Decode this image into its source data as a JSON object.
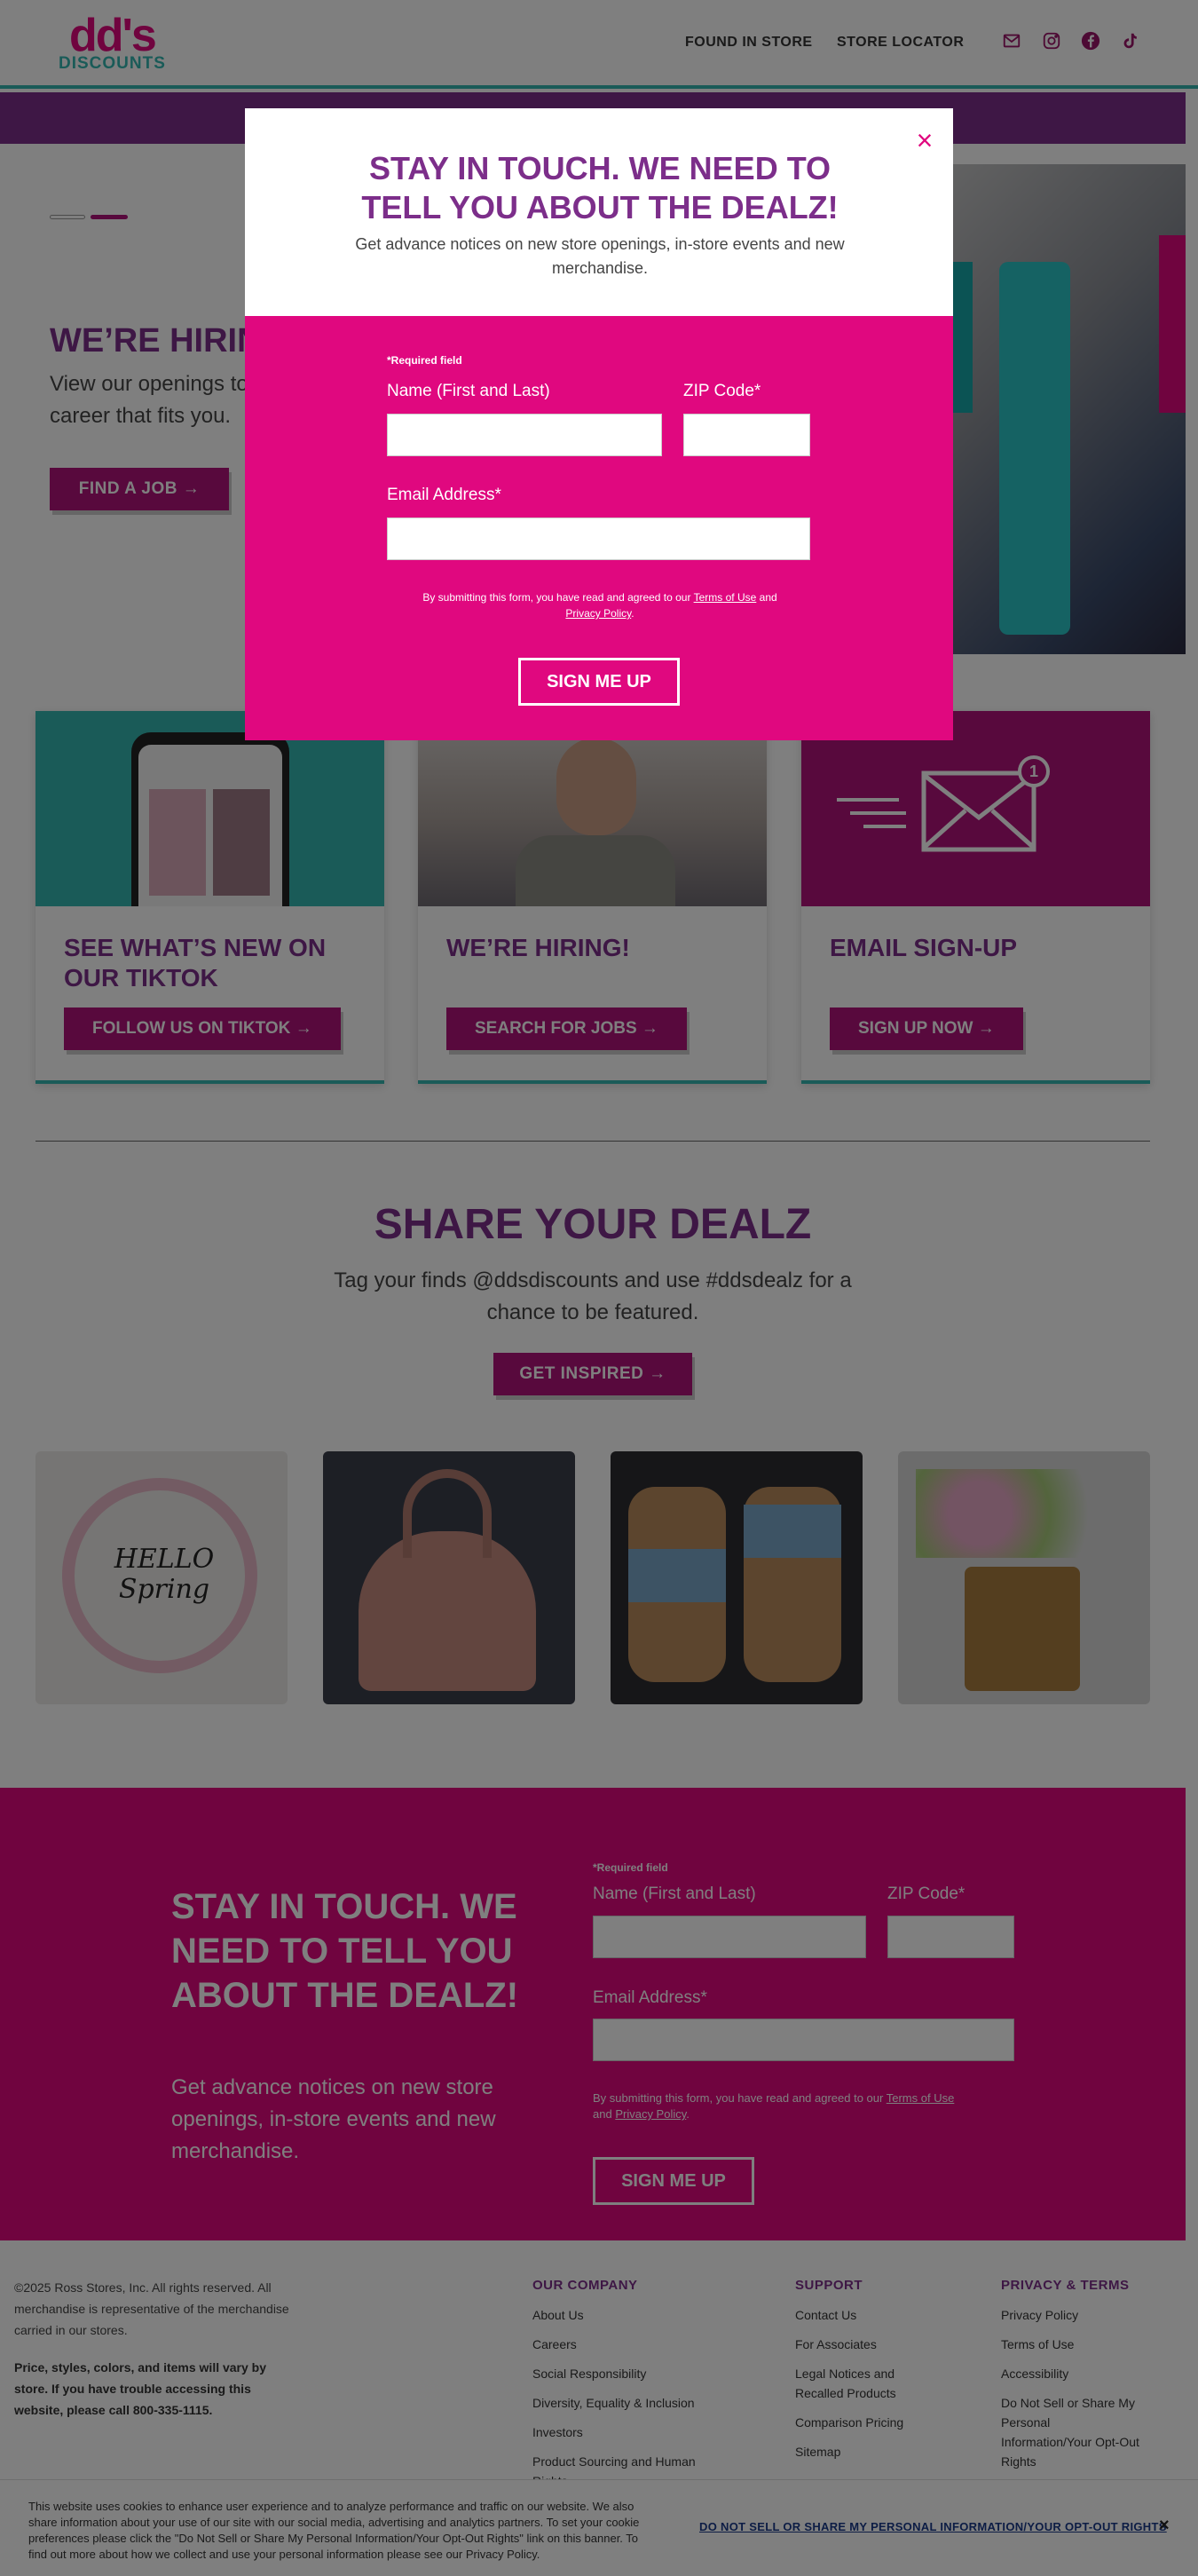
{
  "header": {
    "logo_top": "dd's",
    "logo_bottom": "DISCOUNTS",
    "nav": [
      "FOUND IN STORE",
      "STORE LOCATOR"
    ],
    "social_icons": [
      "mail-icon",
      "instagram-icon",
      "facebook-icon",
      "tiktok-icon"
    ]
  },
  "hero": {
    "title": "WE’RE HIRING!",
    "text": "View our openings today and find the career that fits you.",
    "button": "FIND A JOB"
  },
  "cards": [
    {
      "title": "SEE WHAT’S NEW ON OUR TIKTOK",
      "button": "FOLLOW US ON TIKTOK"
    },
    {
      "title": "WE’RE HIRING!",
      "button": "SEARCH FOR JOBS"
    },
    {
      "title": "EMAIL SIGN-UP",
      "button": "SIGN UP NOW",
      "badge": "1"
    }
  ],
  "share": {
    "title": "SHARE YOUR DEALZ",
    "text": "Tag your finds @ddsdiscounts and use #ddsdealz for a chance to be featured.",
    "button": "GET INSPIRED",
    "photo1_text": "HELLO Spring"
  },
  "signup": {
    "title": "STAY IN TOUCH. WE NEED TO TELL YOU ABOUT THE DEALZ!",
    "text": "Get advance notices on new store openings, in-store events and new merchandise.",
    "required": "*Required field",
    "name_label": "Name (First and Last)",
    "zip_label": "ZIP Code*",
    "email_label": "Email Address*",
    "legal_pre": "By submitting this form, you have read and agreed to our",
    "terms": "Terms of Use",
    "and": "and",
    "privacy": "Privacy Policy",
    "period": ".",
    "button": "SIGN ME UP"
  },
  "footer": {
    "copyright": "©2025 Ross Stores, Inc. All rights reserved. All merchandise is representative of the merchandise carried in our stores.",
    "notice": "Price, styles, colors, and items will vary by store. If you have trouble accessing this website, please call 800-335-1115.",
    "columns": [
      {
        "heading": "OUR COMPANY",
        "links": [
          "About Us",
          "Careers",
          "Social Responsibility",
          "Diversity, Equality & Inclusion",
          "Investors",
          "Product Sourcing and Human Rights"
        ]
      },
      {
        "heading": "SUPPORT",
        "links": [
          "Contact Us",
          "For Associates",
          "Legal Notices and Recalled Products",
          "Comparison Pricing",
          "Sitemap"
        ]
      },
      {
        "heading": "PRIVACY & TERMS",
        "links": [
          "Privacy Policy",
          "Terms of Use",
          "Accessibility",
          "Do Not Sell or Share My Personal Information/Your Opt-Out Rights"
        ]
      }
    ]
  },
  "cookie": {
    "text": "This website uses cookies to enhance user experience and to analyze performance and traffic on our website. We also share information about your use of our site with our social media, advertising and analytics partners. To set your cookie preferences please click the \"Do Not Sell or Share My Personal Information/Your Opt-Out Rights\" link on this banner. To find out more about how we collect and use your personal information please see our Privacy Policy.",
    "link": "DO NOT SELL OR SHARE MY PERSONAL INFORMATION/YOUR OPT-OUT RIGHTS",
    "close": "×"
  },
  "modal": {
    "title": "STAY IN TOUCH. WE NEED TO TELL YOU ABOUT THE DEALZ!",
    "subtitle": "Get advance notices on new store openings, in-store events and new merchandise.",
    "close": "×",
    "required": "*Required field",
    "name_label": "Name (First and Last)",
    "zip_label": "ZIP Code*",
    "email_label": "Email Address*",
    "legal_pre": "By submitting this form, you have read and agreed to our",
    "terms": "Terms of Use",
    "and": "and",
    "privacy": "Privacy Policy",
    "period": ".",
    "button": "SIGN ME UP"
  },
  "colors": {
    "magenta": "#e0087f",
    "purple": "#7c2e8a",
    "teal": "#35b7b0",
    "button": "#b0137a"
  }
}
